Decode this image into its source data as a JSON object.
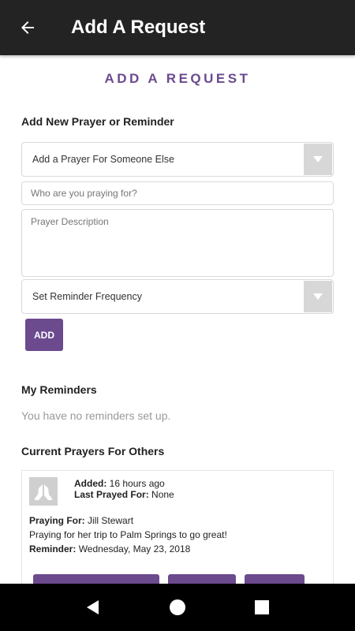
{
  "appbar": {
    "title": "Add A Request",
    "back_icon": "arrow-left-icon"
  },
  "page": {
    "heading": "ADD A REQUEST"
  },
  "form": {
    "section_title": "Add New Prayer or Reminder",
    "type_select": {
      "value": "Add a Prayer For Someone Else"
    },
    "name_input": {
      "value": "",
      "placeholder": "Who are you praying for?"
    },
    "description_input": {
      "value": "",
      "placeholder": "Prayer Description"
    },
    "frequency_select": {
      "value": "Set Reminder Frequency"
    },
    "add_label": "ADD"
  },
  "reminders": {
    "section_title": "My Reminders",
    "empty_text": "You have no reminders set up."
  },
  "prayers": {
    "section_title": "Current Prayers For Others",
    "items": [
      {
        "avatar_icon": "praying-hands-icon",
        "added_label": "Added:",
        "added_value": "16 hours ago",
        "last_prayed_label": "Last Prayed For:",
        "last_prayed_value": "None",
        "praying_for_label": "Praying For:",
        "praying_for_value": "Jill Stewart",
        "description": "Praying for her trip to Palm Springs to go great!",
        "reminder_label": "Reminder:",
        "reminder_value": "Wednesday, May 23, 2018"
      }
    ]
  },
  "navbar": {
    "back_icon": "nav-back-triangle-icon",
    "home_icon": "nav-home-circle-icon",
    "recents_icon": "nav-recents-square-icon"
  },
  "colors": {
    "accent": "#6b4a8e",
    "appbar": "#232323",
    "navbar": "#000000"
  }
}
